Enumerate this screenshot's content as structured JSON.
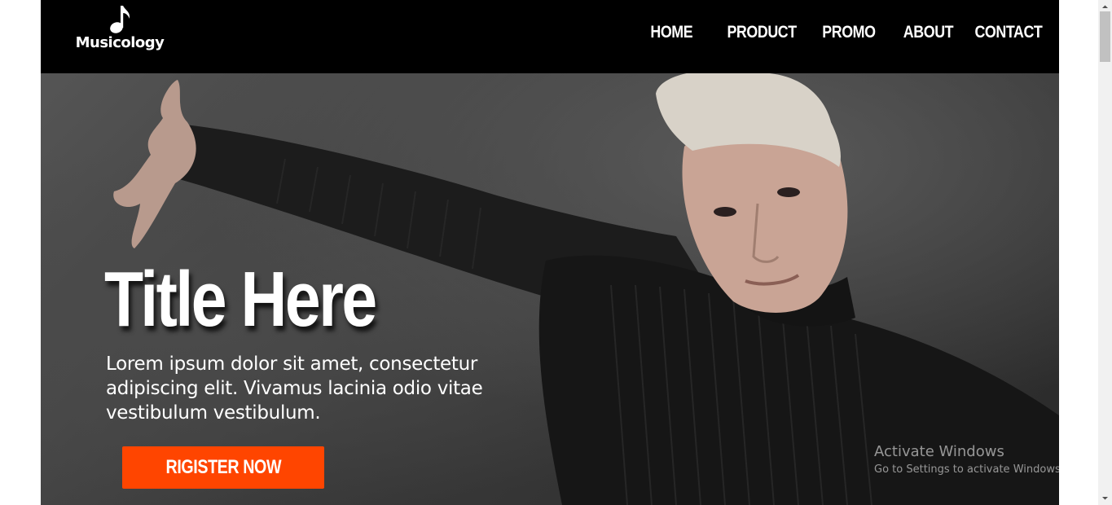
{
  "header": {
    "logo_text": "Musicology",
    "logo_icon": "music-note-icon",
    "nav": [
      {
        "label": "HOME"
      },
      {
        "label": "PRODUCT"
      },
      {
        "label": "PROMO"
      },
      {
        "label": "ABOUT"
      },
      {
        "label": "CONTACT"
      }
    ]
  },
  "hero": {
    "title": "Title Here",
    "text": "Lorem ipsum dolor sit amet, consectetur adipiscing elit. Vivamus lacinia odio vitae vestibulum vestibulum.",
    "cta_label": "RIGISTER NOW",
    "cta_color": "#ff4500"
  },
  "watermark": {
    "title": "Activate Windows",
    "subtitle": "Go to Settings to activate Windows."
  },
  "colors": {
    "header_bg": "#000000",
    "accent": "#ff4500",
    "text": "#ffffff"
  }
}
